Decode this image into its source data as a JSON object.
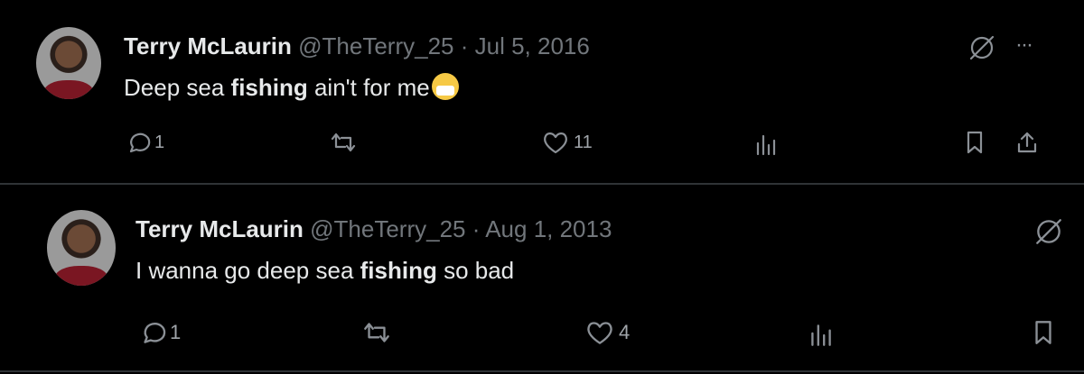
{
  "tweets": [
    {
      "author_name": "Terry McLaurin",
      "handle": "@TheTerry_25",
      "separator": "·",
      "date": "Jul 5, 2016",
      "text_before": "Deep sea ",
      "text_bold": "fishing",
      "text_after": " ain't for me",
      "emoji": "face-with-medical-mask",
      "replies": "1",
      "retweets": "",
      "likes": "11",
      "more_label": "···"
    },
    {
      "author_name": "Terry McLaurin",
      "handle": "@TheTerry_25",
      "separator": "·",
      "date": "Aug 1, 2013",
      "text_before": "I wanna go deep sea ",
      "text_bold": "fishing",
      "text_after": " so bad",
      "replies": "1",
      "retweets": "",
      "likes": "4"
    }
  ],
  "colors": {
    "background": "#000000",
    "primary_text": "#e7e9ea",
    "secondary_text": "#71767b",
    "divider": "#2f3336"
  }
}
